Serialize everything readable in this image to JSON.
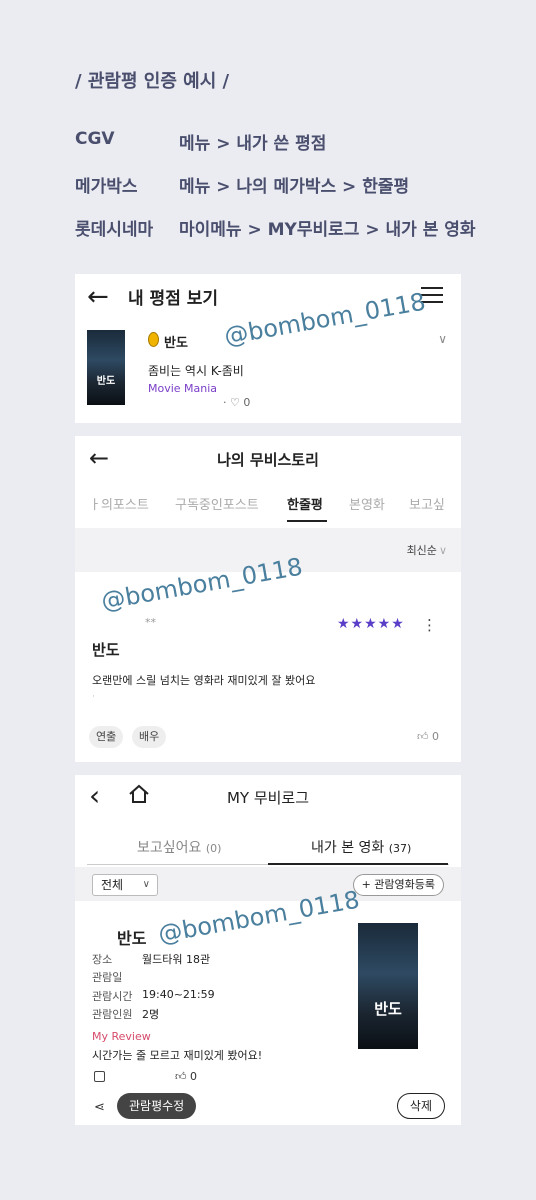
{
  "guide": {
    "title": "/ 관람평 인증 예시 /",
    "rows": [
      {
        "theater": "CGV",
        "path": "메뉴 > 내가 쓴 평점"
      },
      {
        "theater": "메가박스",
        "path": "메뉴 > 나의 메가박스 > 한줄평"
      },
      {
        "theater": "롯데시네마",
        "path": "마이메뉴 > MY무비로그 > 내가 본 영화"
      }
    ]
  },
  "watermark": "@bombom_0118",
  "cgv": {
    "title": "내 평점 보기",
    "movie": "반도",
    "comment": "좀비는 역시 K-좀비",
    "grade": "Movie Mania",
    "likes": "0"
  },
  "megabox": {
    "title": "나의 무비스토리",
    "tabs": [
      "ㅏ의포스트",
      "구독중인포스트",
      "한줄평",
      "본영화",
      "보고싶"
    ],
    "active_tab": "한줄평",
    "sort": "최신순",
    "user_mask": "**",
    "stars": "★★★★★",
    "movie": "반도",
    "comment": "오랜만에 스릴 넘치는 영화라 재미있게 잘 봤어요",
    "chips": [
      "연출",
      "배우"
    ],
    "likes": "0"
  },
  "lotte": {
    "title": "MY 무비로그",
    "tab_wish": "보고싶어요",
    "tab_wish_count": "(0)",
    "tab_seen": "내가 본 영화",
    "tab_seen_count": "(37)",
    "filter": "전체",
    "register_button": "+ 관람영화등록",
    "movie": "반도",
    "info": [
      {
        "label": "장소",
        "value": "월드타워 18관"
      },
      {
        "label": "관람일",
        "value": ""
      },
      {
        "label": "관람시간",
        "value": "19:40~21:59"
      },
      {
        "label": "관람인원",
        "value": "2명"
      }
    ],
    "review_label": "My Review",
    "review": "시간가는 줄 모르고 재미있게 봤어요!",
    "likes": "0",
    "edit_button": "관람평수정",
    "delete_button": "삭제"
  },
  "poster_title": "반도",
  "colors": {
    "accent_purple": "#5a3ec8",
    "review_pink": "#d64b6b",
    "guide_text": "#4a4f6e",
    "watermark": "#4a7f9e"
  },
  "icons": [
    "back-arrow-icon",
    "hamburger-icon",
    "grade-badge-icon",
    "heart-icon",
    "chevron-down-icon",
    "star-icon",
    "kebab-icon",
    "thumbs-up-icon",
    "home-icon",
    "calendar-icon",
    "share-icon"
  ]
}
